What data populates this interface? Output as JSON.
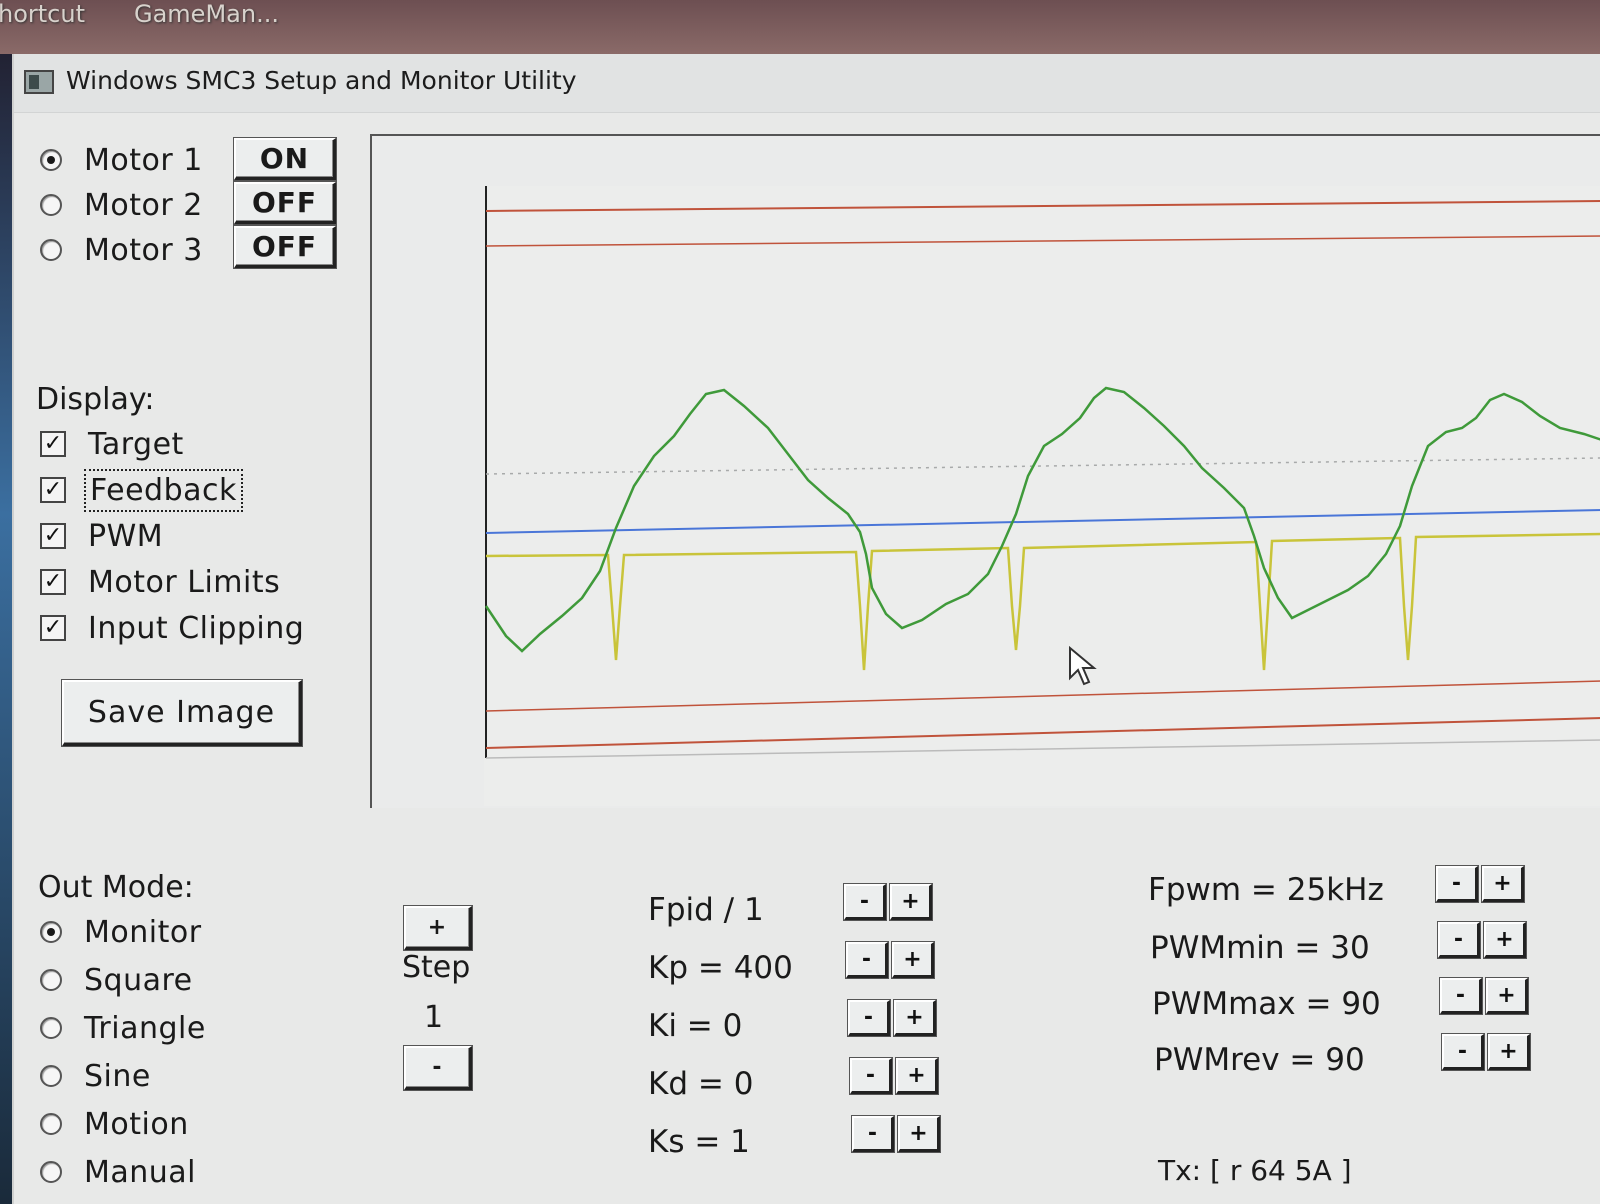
{
  "taskbar": {
    "items": [
      "hortcut",
      "GameMan..."
    ]
  },
  "window": {
    "title": "Windows SMC3 Setup and Monitor Utility"
  },
  "motors": [
    {
      "label": "Motor 1",
      "selected": true,
      "state": "ON"
    },
    {
      "label": "Motor 2",
      "selected": false,
      "state": "OFF"
    },
    {
      "label": "Motor 3",
      "selected": false,
      "state": "OFF"
    }
  ],
  "display": {
    "heading": "Display:",
    "options": [
      {
        "label": "Target",
        "checked": true
      },
      {
        "label": "Feedback",
        "checked": true
      },
      {
        "label": "PWM",
        "checked": true
      },
      {
        "label": "Motor Limits",
        "checked": true
      },
      {
        "label": "Input Clipping",
        "checked": true
      }
    ],
    "check_mark": "✓",
    "save_label": "Save Image"
  },
  "out_mode": {
    "heading": "Out Mode:",
    "options": [
      {
        "label": "Monitor",
        "selected": true
      },
      {
        "label": "Square",
        "selected": false
      },
      {
        "label": "Triangle",
        "selected": false
      },
      {
        "label": "Sine",
        "selected": false
      },
      {
        "label": "Motion",
        "selected": false
      },
      {
        "label": "Manual",
        "selected": false
      }
    ]
  },
  "step": {
    "plus": "+",
    "label": "Step",
    "value": "1",
    "minus": "-"
  },
  "pid_params": [
    {
      "label": "Fpid / 1"
    },
    {
      "label": "Kp = 400"
    },
    {
      "label": "Ki = 0"
    },
    {
      "label": "Kd = 0"
    },
    {
      "label": "Ks = 1"
    }
  ],
  "pwm_params": [
    {
      "label": "Fpwm = 25kHz"
    },
    {
      "label": "PWMmin = 30"
    },
    {
      "label": "PWMmax = 90"
    },
    {
      "label": "PWMrev = 90"
    }
  ],
  "stepper_labels": {
    "minus": "-",
    "plus": "+"
  },
  "tx_status": "Tx: [ r 64 5A ]",
  "colors": {
    "feedback": "#3f9a3a",
    "target": "#4a76d8",
    "pwm": "#c9c43a",
    "limits": "#c0533b",
    "dotted": "#a8aaaa"
  }
}
